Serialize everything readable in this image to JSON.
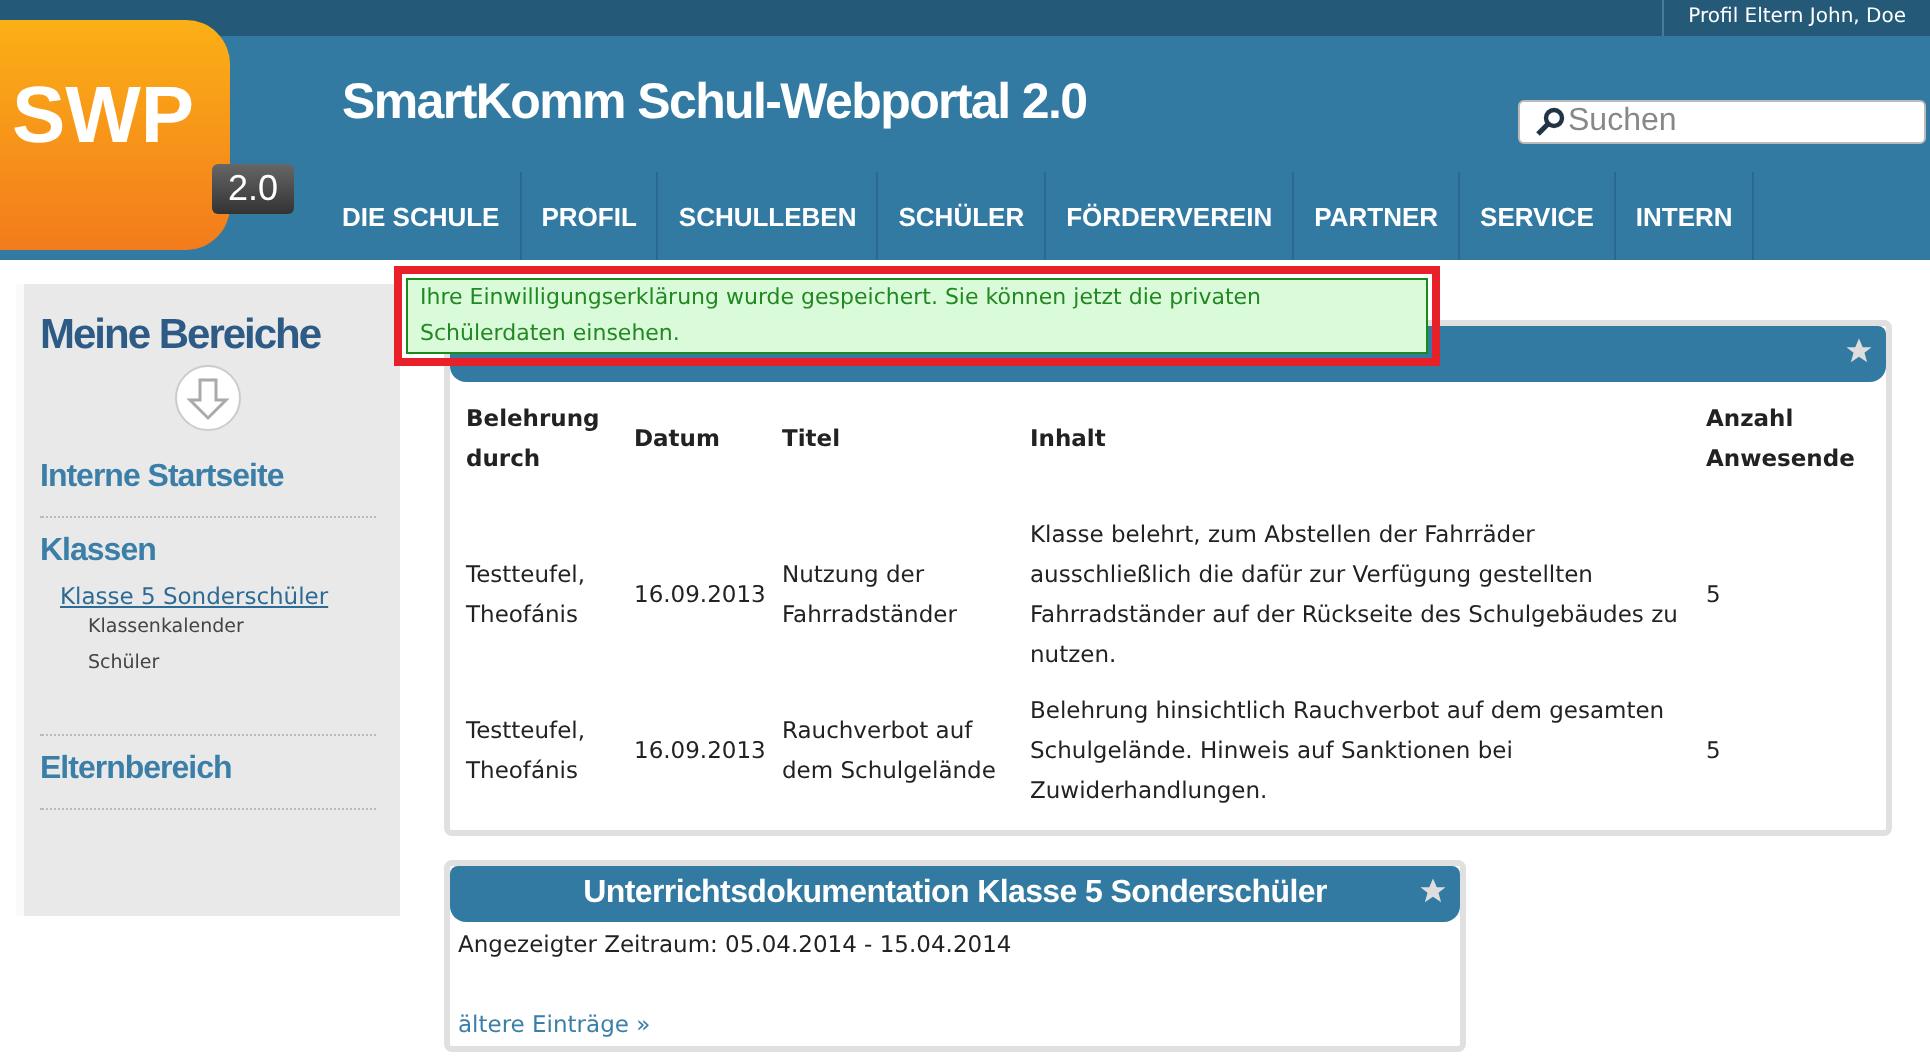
{
  "top_bar": {
    "profile": "Profil Eltern John, Doe"
  },
  "logo": {
    "text": "SWP",
    "version": "2.0"
  },
  "site_title": "SmartKomm Schul-Webportal 2.0",
  "search": {
    "placeholder": "Suchen"
  },
  "nav": [
    "DIE SCHULE",
    "PROFIL",
    "SCHULLEBEN",
    "SCHÜLER",
    "FÖRDERVEREIN",
    "PARTNER",
    "SERVICE",
    "INTERN"
  ],
  "sidebar": {
    "title": "Meine Bereiche",
    "sections": [
      {
        "label": "Interne Startseite"
      },
      {
        "label": "Klassen",
        "children": [
          {
            "label": "Klasse 5 Sonderschüler",
            "children": [
              {
                "label": "Klassenkalender"
              },
              {
                "label": "Schüler"
              }
            ]
          }
        ]
      },
      {
        "label": "Elternbereich"
      }
    ]
  },
  "notice": "Ihre Einwilligungserklärung wurde gespeichert. Sie können jetzt die privaten Schülerdaten einsehen.",
  "instruction_table": {
    "columns": [
      "Belehrung durch",
      "Datum",
      "Titel",
      "Inhalt",
      "Anzahl Anwesende"
    ],
    "rows": [
      [
        "Testteufel, Theofánis",
        "16.09.2013",
        "Nutzung der Fahrradständer",
        "Klasse belehrt, zum Abstellen der Fahrräder ausschließlich die dafür zur Verfügung gestellten Fahrradständer auf der Rückseite des Schulgebäudes zu nutzen.",
        "5"
      ],
      [
        "Testteufel, Theofánis",
        "16.09.2013",
        "Rauchverbot auf dem Schulgelände",
        "Belehrung hinsichtlich Rauchverbot auf dem gesamten Schulgelände. Hinweis auf Sanktionen bei Zuwiderhandlungen.",
        "5"
      ]
    ]
  },
  "lesson_panel": {
    "title": "Unterrichtsdokumentation Klasse 5 Sonderschüler",
    "period": "Angezeigter Zeitraum: 05.04.2014 - 15.04.2014",
    "link": "ältere Einträge »"
  }
}
